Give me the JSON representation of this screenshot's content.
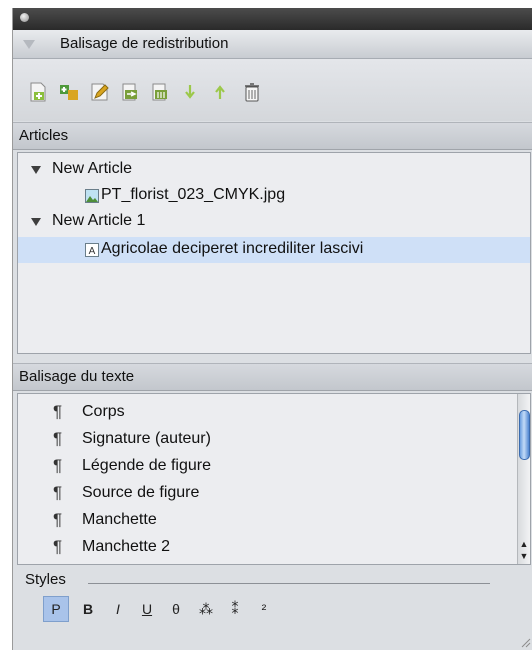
{
  "panel": {
    "title": "Balisage de redistribution",
    "toolbar": [
      {
        "name": "new-article-icon",
        "color": "#8bbf3c"
      },
      {
        "name": "add-items-icon",
        "color": "#4f9a3b"
      },
      {
        "name": "edit-article-icon",
        "color": "#d9a520"
      },
      {
        "name": "import-items-icon",
        "color": "#7a9f3a"
      },
      {
        "name": "import-selection-icon",
        "color": "#7a9f3a"
      },
      {
        "name": "move-down-icon",
        "color": "#9cc84a"
      },
      {
        "name": "move-up-icon",
        "color": "#9cc84a"
      },
      {
        "name": "trash-icon",
        "color": "#555555"
      }
    ]
  },
  "articles": {
    "label": "Articles",
    "tree": [
      {
        "label": "New Article",
        "children": [
          {
            "label": "PT_florist_023_CMYK.jpg",
            "icon": "image-file-icon"
          }
        ]
      },
      {
        "label": "New Article 1",
        "children": [
          {
            "label": "Agricolae deciperet incrediliter lascivi",
            "icon": "text-frame-icon",
            "selected": true
          }
        ]
      }
    ]
  },
  "text_tagging": {
    "label": "Balisage du texte",
    "pilcrow": "¶",
    "items": [
      "Corps",
      "Signature (auteur)",
      "Légende de figure",
      "Source de figure",
      "Manchette",
      "Manchette 2"
    ]
  },
  "styles": {
    "label": "Styles",
    "buttons": [
      {
        "label": "P",
        "active": true,
        "name": "style-paragraph-button"
      },
      {
        "label": "B",
        "name": "style-bold-button"
      },
      {
        "label": "I",
        "name": "style-italic-button"
      },
      {
        "label": "U",
        "name": "style-underline-button"
      },
      {
        "label": "θ",
        "name": "style-strikethrough-button"
      },
      {
        "label": "⁂",
        "name": "style-superscript-button"
      },
      {
        "label": "⁑",
        "name": "style-subscript-button"
      },
      {
        "label": "²",
        "name": "style-small-caps-button"
      }
    ]
  }
}
